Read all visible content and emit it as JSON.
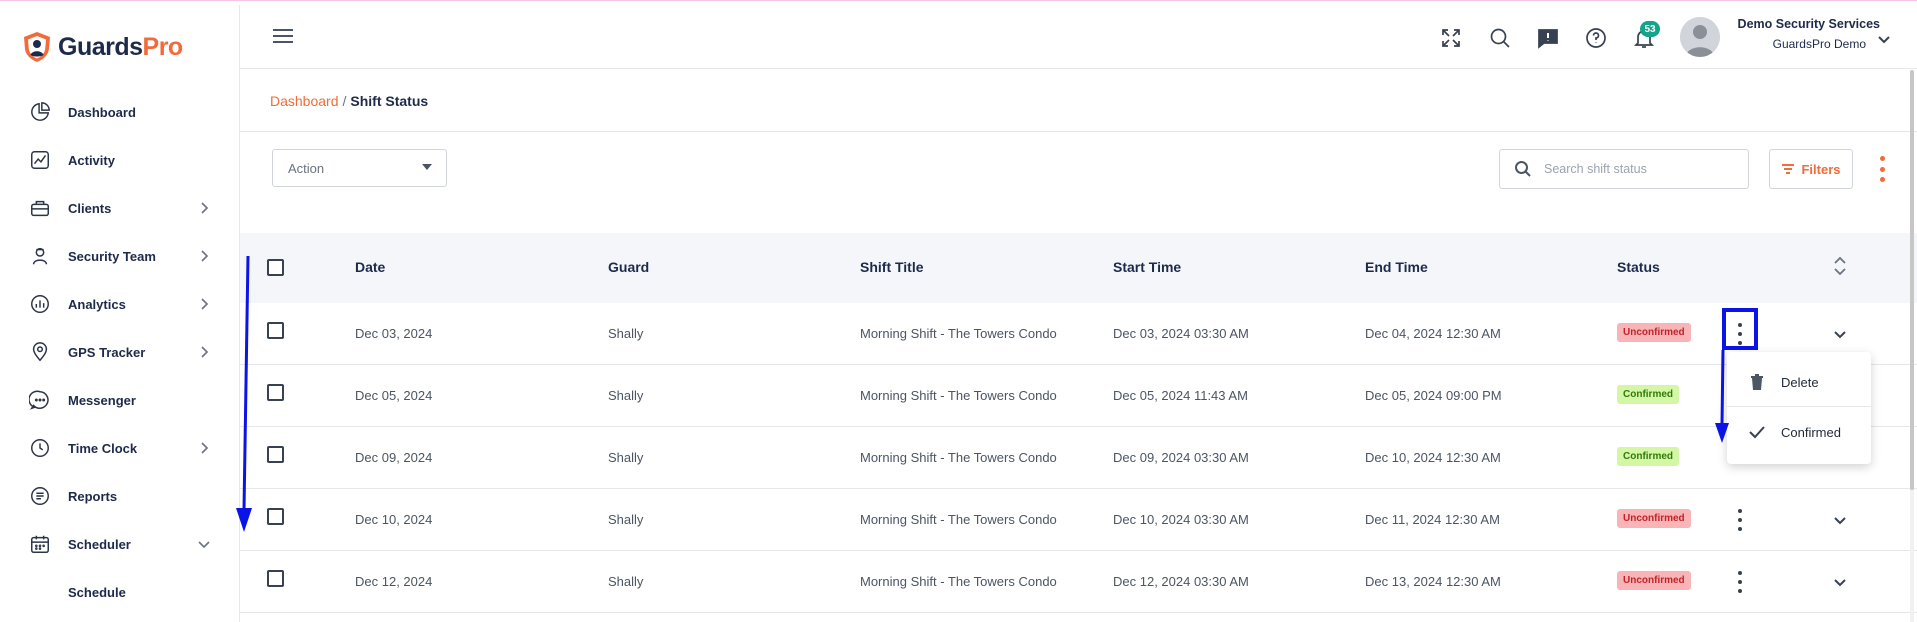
{
  "app": {
    "logo_left": "Guards",
    "logo_right": "Pro"
  },
  "sidebar": {
    "items": [
      {
        "label": "Dashboard",
        "icon": "dashboard-icon",
        "has_arrow": false
      },
      {
        "label": "Activity",
        "icon": "activity-icon",
        "has_arrow": false
      },
      {
        "label": "Clients",
        "icon": "clients-icon",
        "has_arrow": true
      },
      {
        "label": "Security Team",
        "icon": "security-team-icon",
        "has_arrow": true
      },
      {
        "label": "Analytics",
        "icon": "analytics-icon",
        "has_arrow": true
      },
      {
        "label": "GPS Tracker",
        "icon": "gps-icon",
        "has_arrow": true
      },
      {
        "label": "Messenger",
        "icon": "messenger-icon",
        "has_arrow": false
      },
      {
        "label": "Time Clock",
        "icon": "clock-icon",
        "has_arrow": true
      },
      {
        "label": "Reports",
        "icon": "reports-icon",
        "has_arrow": false
      },
      {
        "label": "Scheduler",
        "icon": "calendar-icon",
        "has_arrow": true,
        "expanded": true
      }
    ],
    "sub_items": [
      {
        "label": "Schedule"
      }
    ]
  },
  "header": {
    "notification_count": "53",
    "user_name": "Demo Security Services",
    "user_org": "GuardsPro Demo"
  },
  "breadcrumb": {
    "parent": "Dashboard",
    "separator": "/",
    "current": "Shift Status"
  },
  "toolbar": {
    "action_placeholder": "Action",
    "search_placeholder": "Search shift status",
    "filters_label": "Filters"
  },
  "table": {
    "columns": [
      "Date",
      "Guard",
      "Shift Title",
      "Start Time",
      "End Time",
      "Status"
    ],
    "rows": [
      {
        "date": "Dec 03, 2024",
        "guard": "Shally",
        "title": "Morning Shift - The Towers Condo",
        "start": "Dec 03, 2024 03:30 AM",
        "end": "Dec 04, 2024 12:30 AM",
        "status": "Unconfirmed"
      },
      {
        "date": "Dec 05, 2024",
        "guard": "Shally",
        "title": "Morning Shift - The Towers Condo",
        "start": "Dec 05, 2024 11:43 AM",
        "end": "Dec 05, 2024 09:00 PM",
        "status": "Confirmed"
      },
      {
        "date": "Dec 09, 2024",
        "guard": "Shally",
        "title": "Morning Shift - The Towers Condo",
        "start": "Dec 09, 2024 03:30 AM",
        "end": "Dec 10, 2024 12:30 AM",
        "status": "Confirmed"
      },
      {
        "date": "Dec 10, 2024",
        "guard": "Shally",
        "title": "Morning Shift - The Towers Condo",
        "start": "Dec 10, 2024 03:30 AM",
        "end": "Dec 11, 2024 12:30 AM",
        "status": "Unconfirmed"
      },
      {
        "date": "Dec 12, 2024",
        "guard": "Shally",
        "title": "Morning Shift - The Towers Condo",
        "start": "Dec 12, 2024 03:30 AM",
        "end": "Dec 13, 2024 12:30 AM",
        "status": "Unconfirmed"
      }
    ]
  },
  "row_menu": {
    "items": [
      {
        "label": "Delete",
        "icon": "trash-icon"
      },
      {
        "label": "Confirmed",
        "icon": "check-icon"
      }
    ]
  },
  "colors": {
    "accent": "#f26b3a",
    "annotation": "#0a14e6",
    "unconfirmed_bg": "#f8b4b7",
    "confirmed_bg": "#d4f7a6",
    "badge": "#14a38b"
  }
}
